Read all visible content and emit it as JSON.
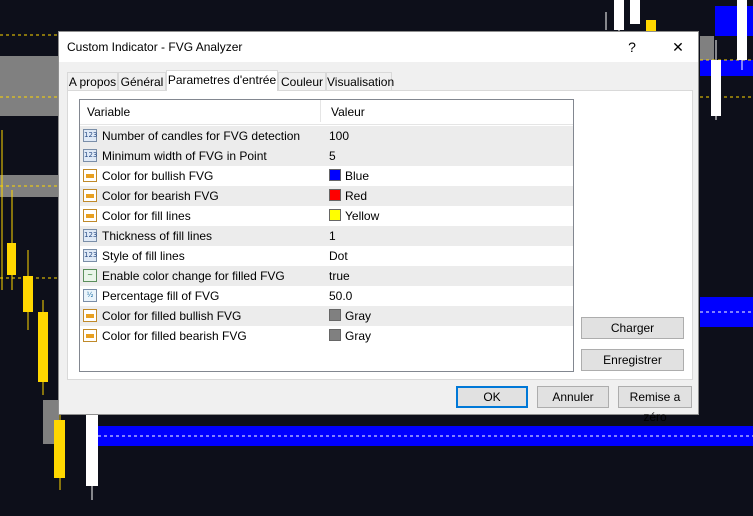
{
  "dialog": {
    "title": "Custom Indicator - FVG Analyzer",
    "help_label": "?",
    "close_label": "✕"
  },
  "tabs": [
    {
      "label": "A propos"
    },
    {
      "label": "Général"
    },
    {
      "label": "Parametres d'entrée"
    },
    {
      "label": "Couleur"
    },
    {
      "label": "Visualisation"
    }
  ],
  "grid": {
    "col_variable": "Variable",
    "col_value": "Valeur",
    "rows": [
      {
        "icon": "int-icon",
        "name": "Number of candles for FVG detection",
        "value": "100"
      },
      {
        "icon": "int-icon",
        "name": "Minimum width of FVG in Point",
        "value": "5"
      },
      {
        "icon": "color-icon",
        "name": "Color for bullish FVG",
        "value": "Blue",
        "swatch": "#0000ff"
      },
      {
        "icon": "color-icon",
        "name": "Color for bearish FVG",
        "value": "Red",
        "swatch": "#ff0000"
      },
      {
        "icon": "color-icon",
        "name": "Color for fill lines",
        "value": "Yellow",
        "swatch": "#ffff00"
      },
      {
        "icon": "int-icon",
        "name": "Thickness of fill lines",
        "value": "1"
      },
      {
        "icon": "int-icon",
        "name": "Style of fill lines",
        "value": "Dot"
      },
      {
        "icon": "bool-icon",
        "name": "Enable color change for filled FVG",
        "value": "true"
      },
      {
        "icon": "double-icon",
        "name": "Percentage fill of FVG",
        "value": "50.0"
      },
      {
        "icon": "color-icon",
        "name": "Color for filled bullish FVG",
        "value": "Gray",
        "swatch": "#808080"
      },
      {
        "icon": "color-icon",
        "name": "Color for filled bearish FVG",
        "value": "Gray",
        "swatch": "#808080"
      }
    ]
  },
  "buttons": {
    "charger": "Charger",
    "enregistrer": "Enregistrer",
    "ok": "OK",
    "annuler": "Annuler",
    "remise": "Remise a zéro"
  },
  "colors": {
    "chart_bg": "#0d0f1a",
    "bull_candle": "#ffffff",
    "bear_candle": "#ffd700",
    "fvg_blue": "#0000ff",
    "fvg_gray": "#808080"
  }
}
